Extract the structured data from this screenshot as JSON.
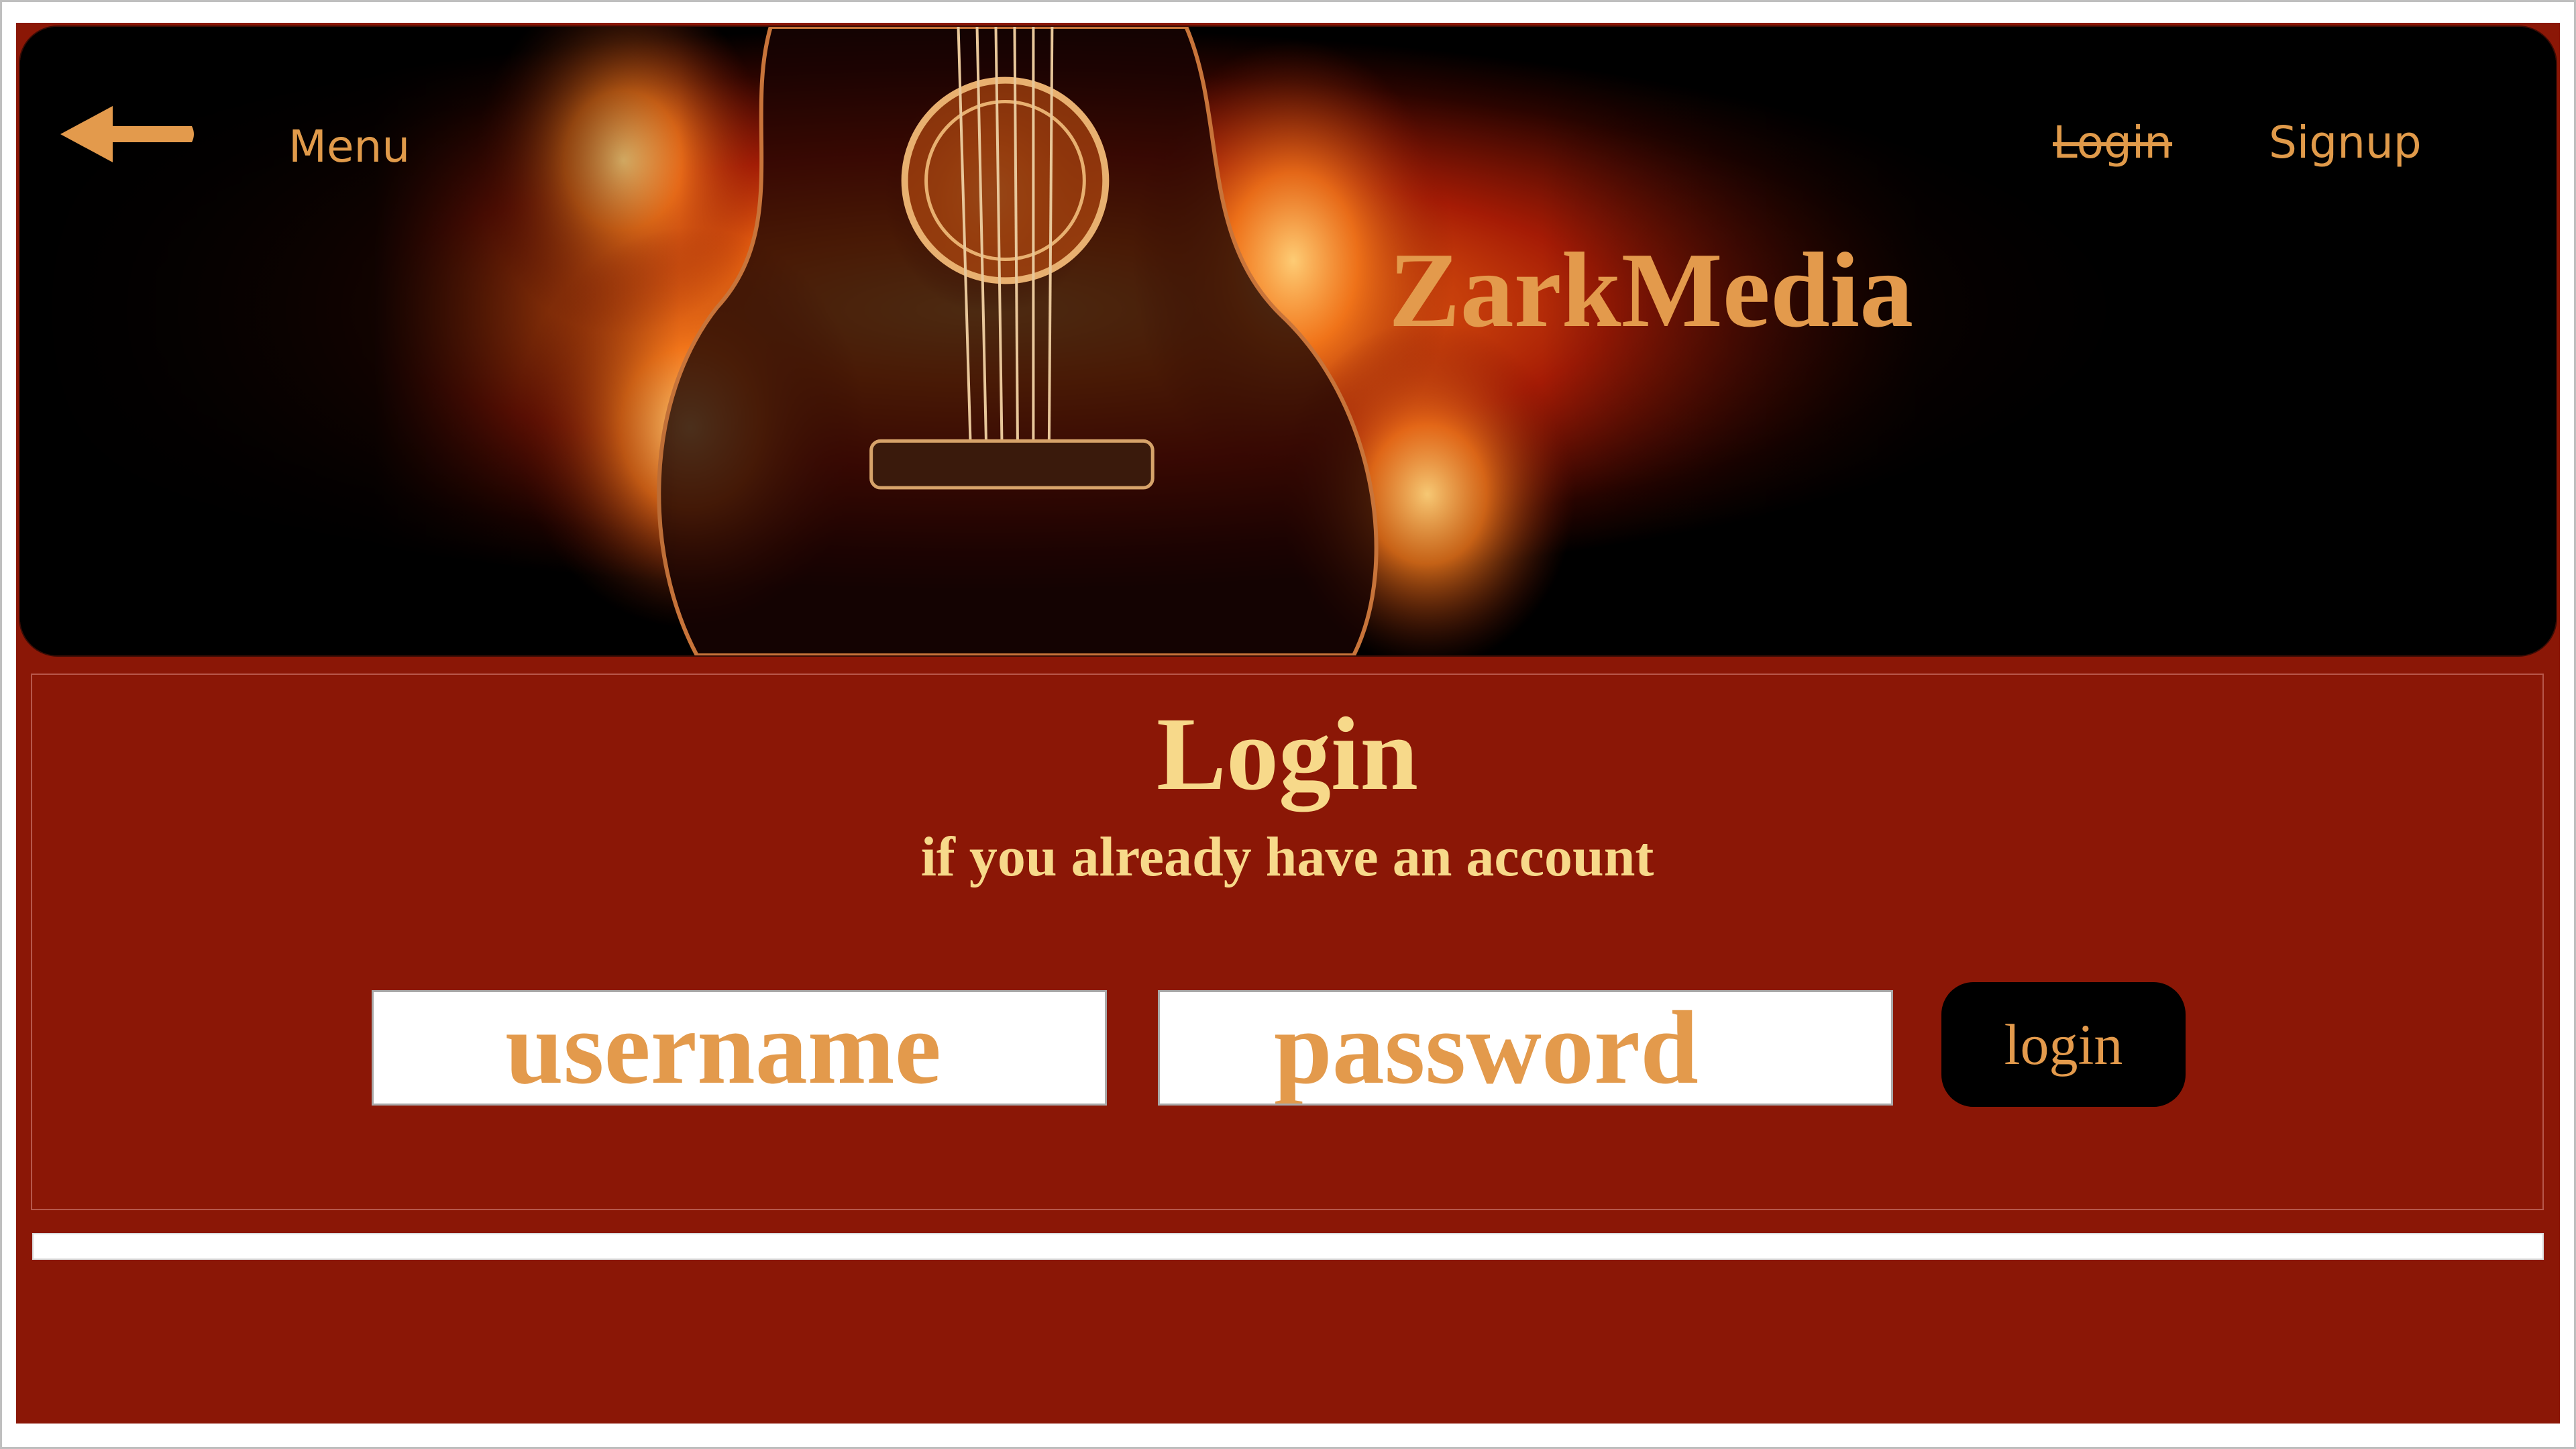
{
  "colors": {
    "page_background": "#8b1706",
    "accent_orange": "#e39a4c",
    "title_yellow": "#f7d98a",
    "button_black": "#000000"
  },
  "header": {
    "back_icon": "arrow-left-icon",
    "menu_label": "Menu",
    "login_label": "Login",
    "signup_label": "Signup",
    "brand": "ZarkMedia",
    "hero_image": "flaming-guitar"
  },
  "login": {
    "title": "Login",
    "subtitle": "if you already have an account",
    "username_placeholder": "username",
    "username_value": "",
    "password_placeholder": "password",
    "password_value": "",
    "submit_label": "login"
  }
}
